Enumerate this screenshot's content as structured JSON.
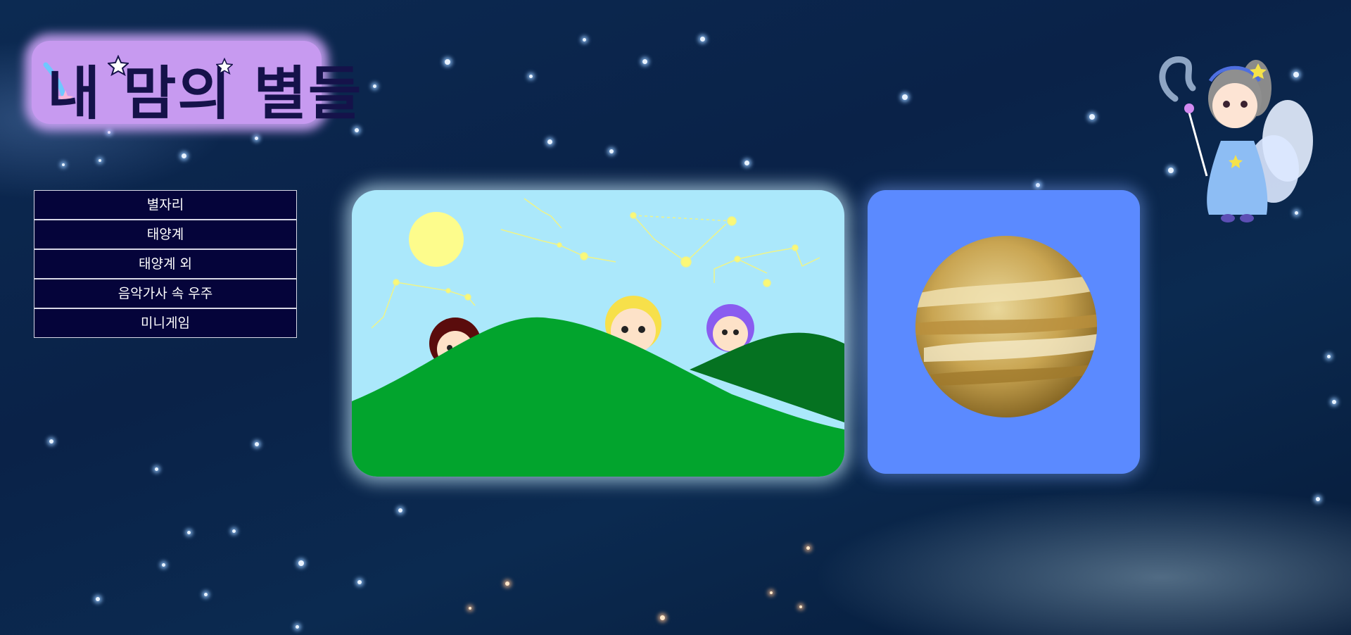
{
  "site": {
    "title": "내 맘의 별들"
  },
  "menu": {
    "items": [
      {
        "label": "별자리"
      },
      {
        "label": "태양계"
      },
      {
        "label": "태양계 외"
      },
      {
        "label": "음악가사 속 우주"
      },
      {
        "label": "미니게임"
      }
    ]
  },
  "colors": {
    "menu_background": "#05043a",
    "logo_background": "#c79af0",
    "logo_text": "#15124a",
    "scene_sky": "#abe8fb",
    "planet_card": "#5b8aff",
    "hill_light": "#02a42d",
    "hill_dark": "#057221"
  },
  "icons": {
    "logo_star": "star-icon",
    "logo_comet": "comet-icon"
  }
}
